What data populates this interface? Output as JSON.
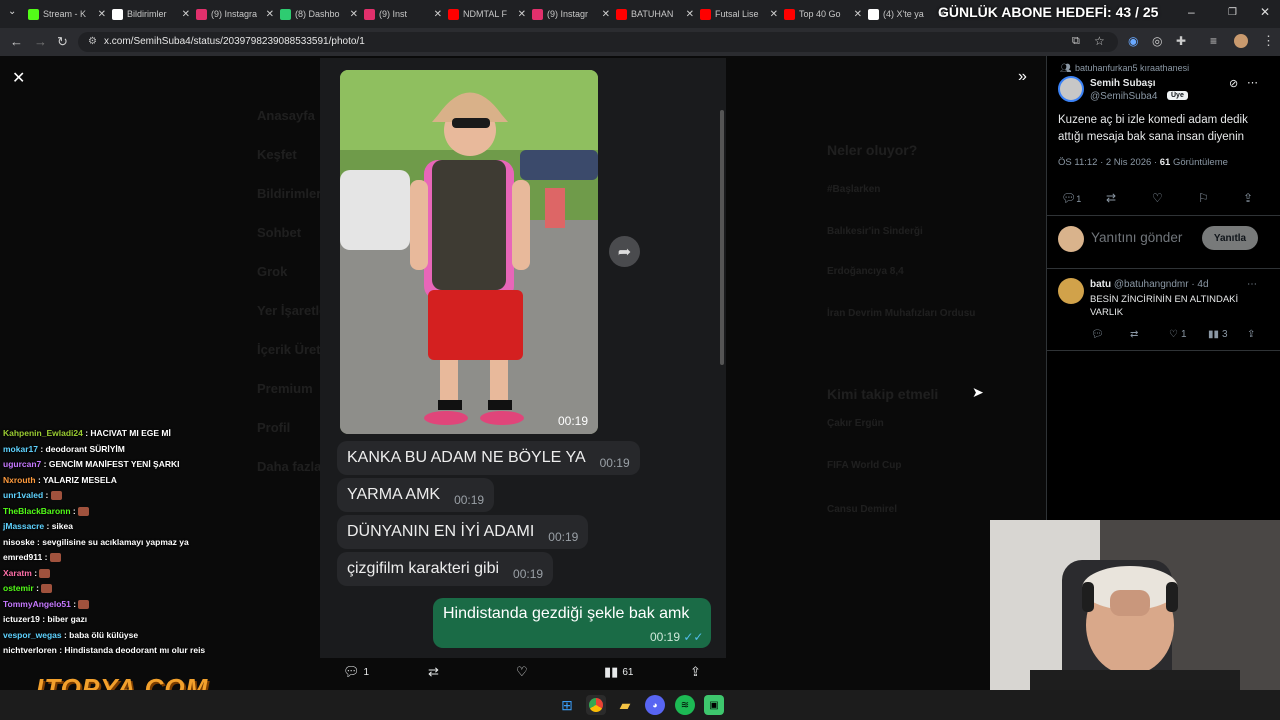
{
  "browser": {
    "tabs": [
      {
        "label": "Stream - K",
        "color": "#53fc18"
      },
      {
        "label": "Bildirimler",
        "color": "#ffffff"
      },
      {
        "label": "(9) Instagra",
        "color": "#e1306c"
      },
      {
        "label": "(8) Dashbo",
        "color": "#2ecc71"
      },
      {
        "label": "(9) Inst",
        "color": "#e1306c"
      },
      {
        "label": "NDMTAL F",
        "color": "#ff0000"
      },
      {
        "label": "(9) Instagr",
        "color": "#e1306c"
      },
      {
        "label": "BATUHAN",
        "color": "#ff0000"
      },
      {
        "label": "Futsal Lise",
        "color": "#ff0000"
      },
      {
        "label": "Top 40 Go",
        "color": "#ff0000"
      },
      {
        "label": "(4) X'te ya",
        "color": "#ffffff"
      }
    ],
    "url": "x.com/SemihSuba4/status/2039798239088533591/photo/1"
  },
  "overlay": {
    "abone_goal": "GÜNLÜK ABONE HEDEFİ: 43 / 25"
  },
  "photo": {
    "video_time": "00:19",
    "messages": [
      {
        "text": "KANKA BU ADAM NE BÖYLE YA",
        "time": "00:19"
      },
      {
        "text": "YARMA AMK",
        "time": "00:19"
      },
      {
        "text": "DÜNYANIN EN İYİ ADAMI",
        "time": "00:19"
      },
      {
        "text": "çizgifilm karakteri gibi",
        "time": "00:19"
      }
    ],
    "outgoing": {
      "text": "Hindistanda gezdiği şekle bak amk",
      "time": "00:19"
    },
    "actions": {
      "replies": "1",
      "views": "61"
    }
  },
  "ghost_sidebar": [
    "Anasayfa",
    "Keşfet",
    "Bildirimler",
    "Sohbet",
    "Grok",
    "Yer İşaretleri",
    "İçerik Üreticileri",
    "Premium",
    "Profil",
    "Daha fazla"
  ],
  "ghost_right": [
    "Neler oluyor?",
    "#Başlarken",
    "Balıkesir'in Sinderği",
    "Erdoğancıya 8,4",
    "İran Devrim Muhafızları Ordusu",
    "Kimi takip etmeli",
    "Çakır Ergün",
    "FIFA World Cup",
    "Cansu Demirel"
  ],
  "tweet": {
    "repost_line": "batuhanfurkan5 kıraathanesi",
    "author_name": "Semih Subaşı",
    "author_handle": "@SemihSuba4",
    "badge": "Üye",
    "text": "Kuzene aç bi izle komedi adam dedik attığı mesaja bak sana insan diyenin",
    "meta_time": "ÖS 11:12 · 2 Nis 2026 · ",
    "meta_views": "61",
    "meta_views_label": " Görüntüleme",
    "reply_count": "1",
    "reply_placeholder": "Yanıtını gönder",
    "reply_button": "Yanıtla"
  },
  "comment": {
    "name": "batu",
    "handle": "@batuhangndmr · 4d",
    "text": "BESİN ZİNCİRİNİN EN ALTINDAKİ VARLIK",
    "likes": "1",
    "views": "3"
  },
  "chat": [
    {
      "user": "Kahpenin_Ewladi24",
      "color": "#9acd32",
      "text": "HACIVAT MI EGE Mİ",
      "emote": false
    },
    {
      "user": "mokar17",
      "color": "#5fd3ff",
      "text": "deodorant SÜRİYİM",
      "emote": false
    },
    {
      "user": "ugurcan7",
      "color": "#c679ff",
      "text": "GENCİM MANİFEST YENİ ŞARKI",
      "emote": false
    },
    {
      "user": "Nxrouth",
      "color": "#ff9b3d",
      "text": "YALARIZ MESELA",
      "emote": false
    },
    {
      "user": "unr1valed",
      "color": "#5fd3ff",
      "text": "",
      "emote": true
    },
    {
      "user": "TheBlackBaronn",
      "color": "#53fc18",
      "text": "",
      "emote": true
    },
    {
      "user": "jMassacre",
      "color": "#5fd3ff",
      "text": "sikea",
      "emote": false
    },
    {
      "user": "nisoske",
      "color": "#ffffff",
      "text": "sevgilisine su acıklamayı yapmaz ya",
      "emote": false
    },
    {
      "user": "emred911",
      "color": "#ffffff",
      "text": "",
      "emote": true
    },
    {
      "user": "Xaratm",
      "color": "#ff6fa8",
      "text": "",
      "emote": true
    },
    {
      "user": "ostemir",
      "color": "#53fc18",
      "text": "",
      "emote": true
    },
    {
      "user": "TommyAngelo51",
      "color": "#c679ff",
      "text": "",
      "emote": true
    },
    {
      "user": "ictuzer19",
      "color": "#ffffff",
      "text": "biber gazı",
      "emote": false
    },
    {
      "user": "vespor_wegas",
      "color": "#5fd3ff",
      "text": "baba ölü külüyse",
      "emote": false
    },
    {
      "user": "nichtverloren",
      "color": "#ffffff",
      "text": "Hindistanda deodorant mı olur reis",
      "emote": false
    }
  ],
  "logo": "ITOPYA.COM",
  "colors": {
    "accent_green": "#1a6b46",
    "x_background": "#000000",
    "text_secondary": "#8b98a5"
  }
}
